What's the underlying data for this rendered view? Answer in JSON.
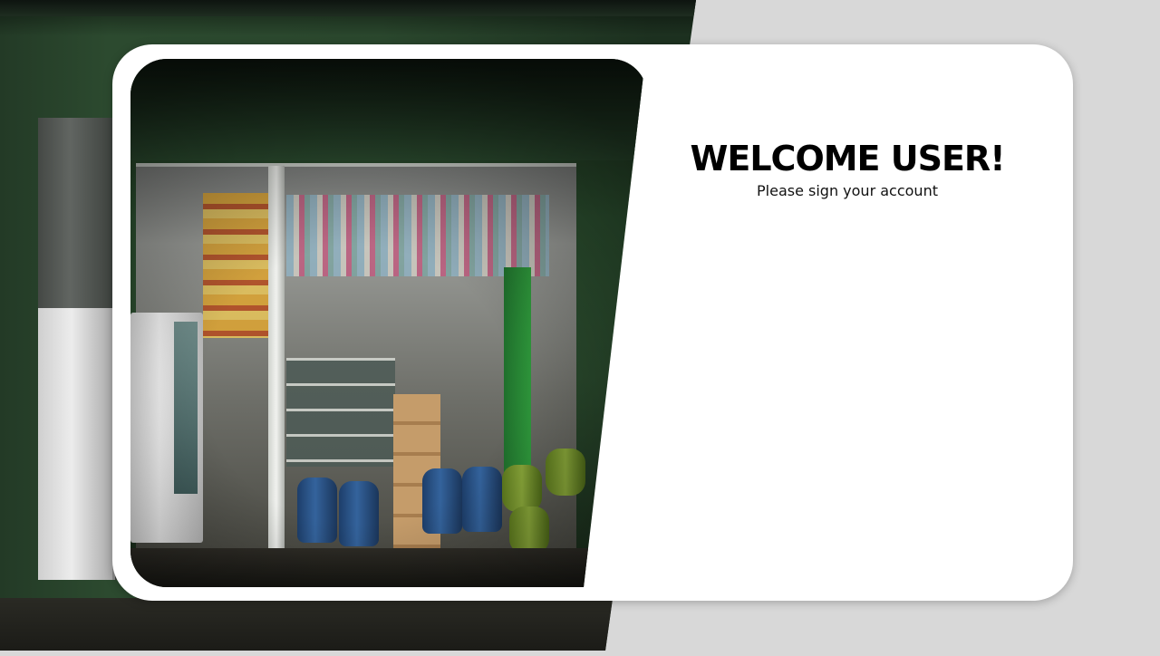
{
  "login": {
    "title": "WELCOME USER!",
    "subtitle": "Please sign your account"
  },
  "colors": {
    "page_background": "#d8d8d8",
    "card_background": "#ffffff",
    "title_color": "#000000",
    "storefront_green": "#2d5231"
  },
  "images": {
    "background_photo": "storefront-photo",
    "card_photo": "shop-interior-photo"
  }
}
